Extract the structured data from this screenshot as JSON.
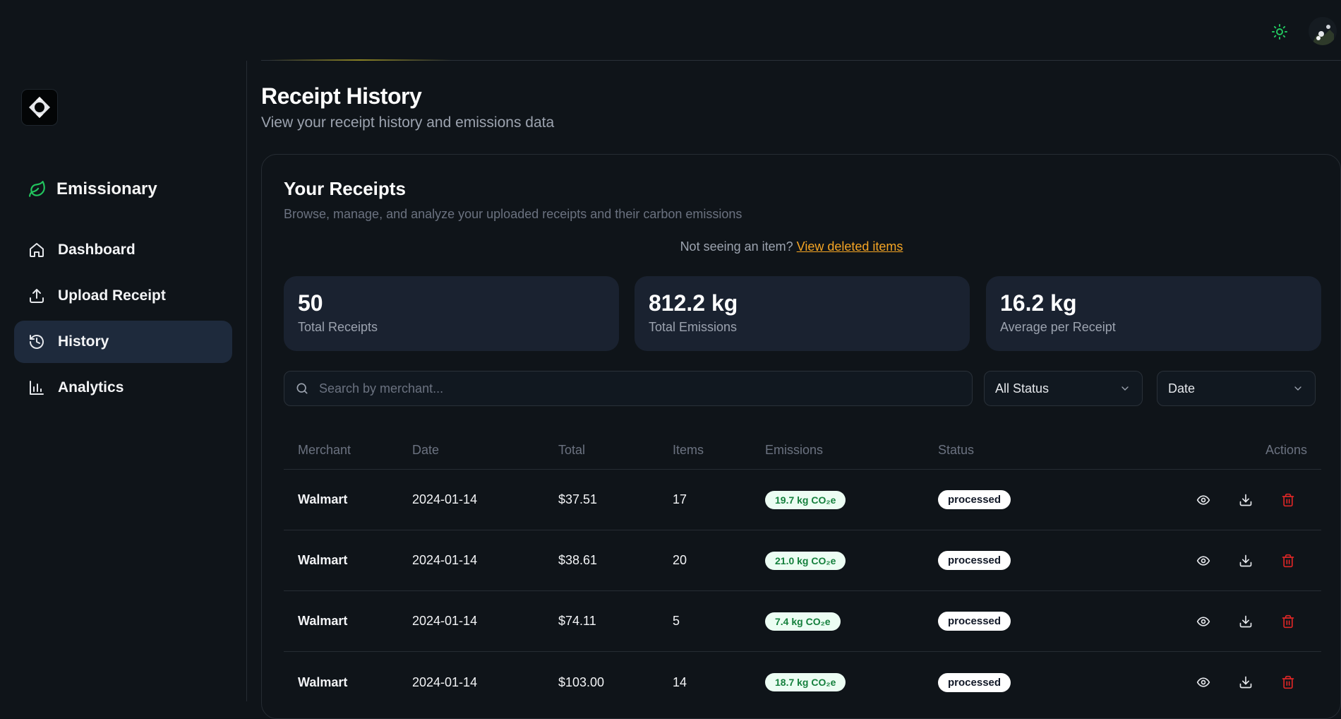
{
  "app": {
    "name": "Emissionary"
  },
  "nav": {
    "items": [
      {
        "label": "Dashboard",
        "icon": "home-icon"
      },
      {
        "label": "Upload Receipt",
        "icon": "upload-icon"
      },
      {
        "label": "History",
        "icon": "history-icon",
        "active": true
      },
      {
        "label": "Analytics",
        "icon": "bar-chart-icon"
      }
    ]
  },
  "page": {
    "title": "Receipt History",
    "subtitle": "View your receipt history and emissions data"
  },
  "card": {
    "title": "Your Receipts",
    "description": "Browse, manage, and analyze your uploaded receipts and their carbon emissions",
    "notice_text": "Not seeing an item?",
    "notice_link": "View deleted items"
  },
  "stats": [
    {
      "value": "50",
      "label": "Total Receipts"
    },
    {
      "value": "812.2 kg",
      "label": "Total Emissions"
    },
    {
      "value": "16.2 kg",
      "label": "Average per Receipt"
    }
  ],
  "filters": {
    "search_placeholder": "Search by merchant...",
    "status_value": "All Status",
    "sort_value": "Date"
  },
  "table": {
    "headers": [
      "Merchant",
      "Date",
      "Total",
      "Items",
      "Emissions",
      "Status",
      "Actions"
    ],
    "rows": [
      {
        "merchant": "Walmart",
        "date": "2024-01-14",
        "total": "$37.51",
        "items": "17",
        "emissions": "19.7 kg CO₂e",
        "status": "processed"
      },
      {
        "merchant": "Walmart",
        "date": "2024-01-14",
        "total": "$38.61",
        "items": "20",
        "emissions": "21.0 kg CO₂e",
        "status": "processed"
      },
      {
        "merchant": "Walmart",
        "date": "2024-01-14",
        "total": "$74.11",
        "items": "5",
        "emissions": "7.4 kg CO₂e",
        "status": "processed"
      },
      {
        "merchant": "Walmart",
        "date": "2024-01-14",
        "total": "$103.00",
        "items": "14",
        "emissions": "18.7 kg CO₂e",
        "status": "processed"
      }
    ]
  },
  "colors": {
    "background": "#0f1419",
    "accent_green": "#22c55e",
    "link_orange": "#f5a524",
    "delete_red": "#dc2626",
    "active_nav": "#1e2a3c"
  }
}
